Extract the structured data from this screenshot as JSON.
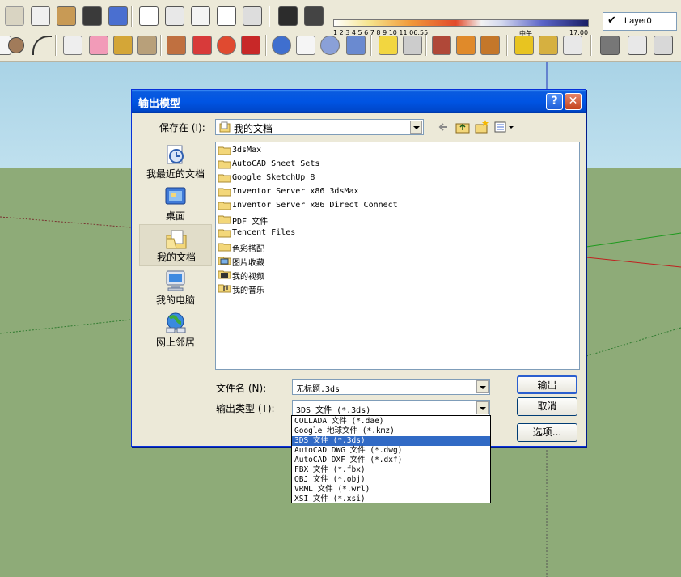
{
  "toolbar": {
    "shadow_ticks": "1  2  3  4  5  6  7  8  9  10  11  06:55",
    "shadow_noon": "中午",
    "shadow_evening": "17:00",
    "layer_name": "Layer0"
  },
  "dialog": {
    "title": "输出模型",
    "help_label": "?",
    "close_label": "✕",
    "save_in_label": "保存在 (I):",
    "save_in_value": "我的文档",
    "places": [
      {
        "label": "我最近的文档",
        "icon": "recent-documents-icon",
        "selected": false
      },
      {
        "label": "桌面",
        "icon": "desktop-icon",
        "selected": false
      },
      {
        "label": "我的文档",
        "icon": "my-documents-icon",
        "selected": true
      },
      {
        "label": "我的电脑",
        "icon": "my-computer-icon",
        "selected": false
      },
      {
        "label": "网上邻居",
        "icon": "network-places-icon",
        "selected": false
      }
    ],
    "files": [
      "3dsMax",
      "AutoCAD Sheet Sets",
      "Google SketchUp 8",
      "Inventor Server x86 3dsMax",
      "Inventor Server x86 Direct Connect",
      "PDF 文件",
      "Tencent Files",
      "色彩搭配",
      "图片收藏",
      "我的视频",
      "我的音乐"
    ],
    "filename_label": "文件名 (N):",
    "filename_value": "无标题.3ds",
    "filetype_label": "输出类型 (T):",
    "filetype_value": "3DS 文件 (*.3ds)",
    "export_button": "输出",
    "cancel_button": "取消",
    "options_button": "选项...",
    "filetype_options": [
      "COLLADA 文件 (*.dae)",
      "Google 地球文件 (*.kmz)",
      "3DS 文件 (*.3ds)",
      "AutoCAD DWG 文件 (*.dwg)",
      "AutoCAD DXF 文件 (*.dxf)",
      "FBX 文件 (*.fbx)",
      "OBJ 文件 (*.obj)",
      "VRML 文件 (*.wrl)",
      "XSI 文件 (*.xsi)"
    ],
    "filetype_selected_index": 2
  }
}
